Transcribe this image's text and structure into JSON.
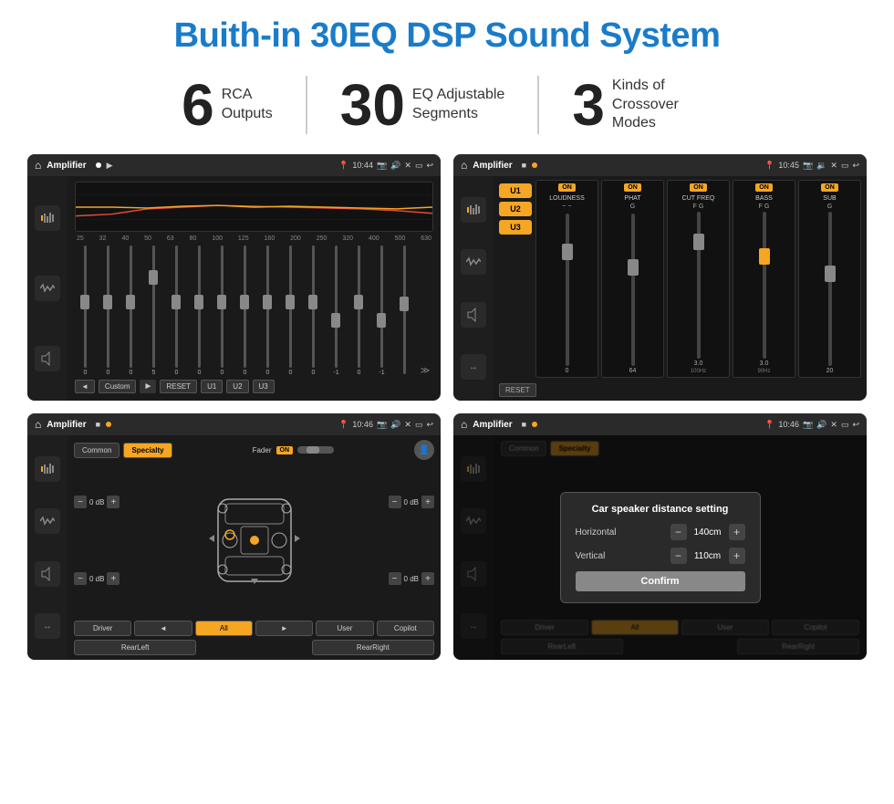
{
  "header": {
    "title": "Buith-in 30EQ DSP Sound System"
  },
  "stats": [
    {
      "number": "6",
      "desc_line1": "RCA",
      "desc_line2": "Outputs"
    },
    {
      "number": "30",
      "desc_line1": "EQ Adjustable",
      "desc_line2": "Segments"
    },
    {
      "number": "3",
      "desc_line1": "Kinds of",
      "desc_line2": "Crossover Modes"
    }
  ],
  "screens": [
    {
      "id": "screen1",
      "topbar": {
        "title": "Amplifier",
        "time": "10:44"
      },
      "eq_freqs": [
        "25",
        "32",
        "40",
        "50",
        "63",
        "80",
        "100",
        "125",
        "160",
        "200",
        "250",
        "320",
        "400",
        "500",
        "630"
      ],
      "eq_values": [
        "0",
        "0",
        "0",
        "5",
        "0",
        "0",
        "0",
        "0",
        "0",
        "0",
        "0",
        "-1",
        "0",
        "-1",
        ""
      ],
      "bottom_btns": [
        "◄",
        "Custom",
        "►",
        "RESET",
        "U1",
        "U2",
        "U3"
      ]
    },
    {
      "id": "screen2",
      "topbar": {
        "title": "Amplifier",
        "time": "10:45"
      },
      "u_buttons": [
        "U1",
        "U2",
        "U3"
      ],
      "controls": [
        {
          "label": "LOUDNESS",
          "on": true
        },
        {
          "label": "PHAT",
          "on": true
        },
        {
          "label": "CUT FREQ",
          "on": true
        },
        {
          "label": "BASS",
          "on": true
        },
        {
          "label": "SUB",
          "on": true
        }
      ],
      "reset_label": "RESET"
    },
    {
      "id": "screen3",
      "topbar": {
        "title": "Amplifier",
        "time": "10:46"
      },
      "tabs": [
        "Common",
        "Specialty"
      ],
      "fader_label": "Fader",
      "fader_on": "ON",
      "db_values": [
        "0 dB",
        "0 dB",
        "0 dB",
        "0 dB"
      ],
      "bottom_btns": [
        "Driver",
        "◄",
        "All",
        "►",
        "User",
        "Copilot",
        "RearLeft",
        "RearRight"
      ]
    },
    {
      "id": "screen4",
      "topbar": {
        "title": "Amplifier",
        "time": "10:46"
      },
      "tabs": [
        "Common",
        "Specialty"
      ],
      "dialog": {
        "title": "Car speaker distance setting",
        "horizontal_label": "Horizontal",
        "horizontal_value": "140cm",
        "vertical_label": "Vertical",
        "vertical_value": "110cm",
        "confirm_label": "Confirm"
      },
      "bottom_btns": [
        "Driver",
        "RearLeft",
        "All",
        "User",
        "Copilot",
        "RearRight"
      ]
    }
  ]
}
